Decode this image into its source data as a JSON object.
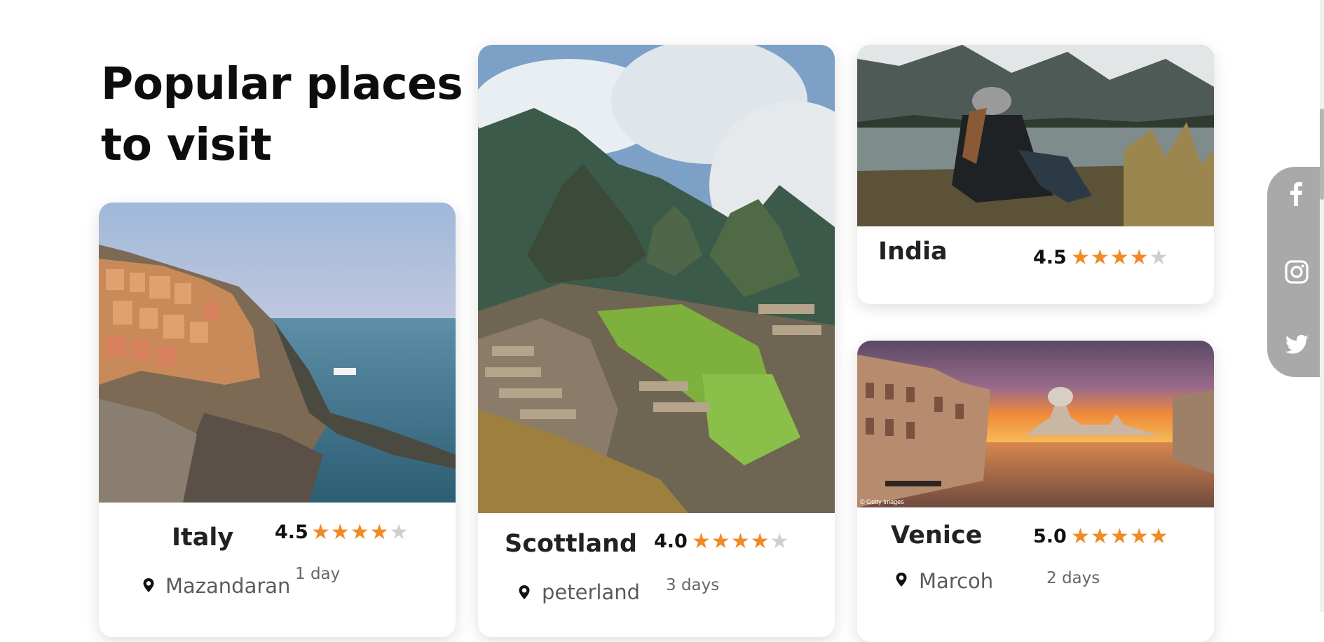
{
  "heading": {
    "line1": "Popular places",
    "line2": "to visit"
  },
  "cards": [
    {
      "name": "Italy",
      "rating": "4.5",
      "stars": 4.5,
      "location": "Mazandaran",
      "duration": "1 day"
    },
    {
      "name": "Scottland",
      "rating": "4.0",
      "stars": 4,
      "location": "peterland",
      "duration": "3 days"
    },
    {
      "name": "India",
      "rating": "4.5",
      "stars": 4.5
    },
    {
      "name": "Venice",
      "rating": "5.0",
      "stars": 5,
      "location": "Marcoh",
      "duration": "2 days"
    }
  ],
  "social": [
    "facebook-icon",
    "instagram-icon",
    "twitter-icon"
  ],
  "colors": {
    "star": "#f08a24",
    "star_empty": "#cfcfcf",
    "social_bar": "#a9a9a9"
  },
  "watermark": "© Getty Images"
}
